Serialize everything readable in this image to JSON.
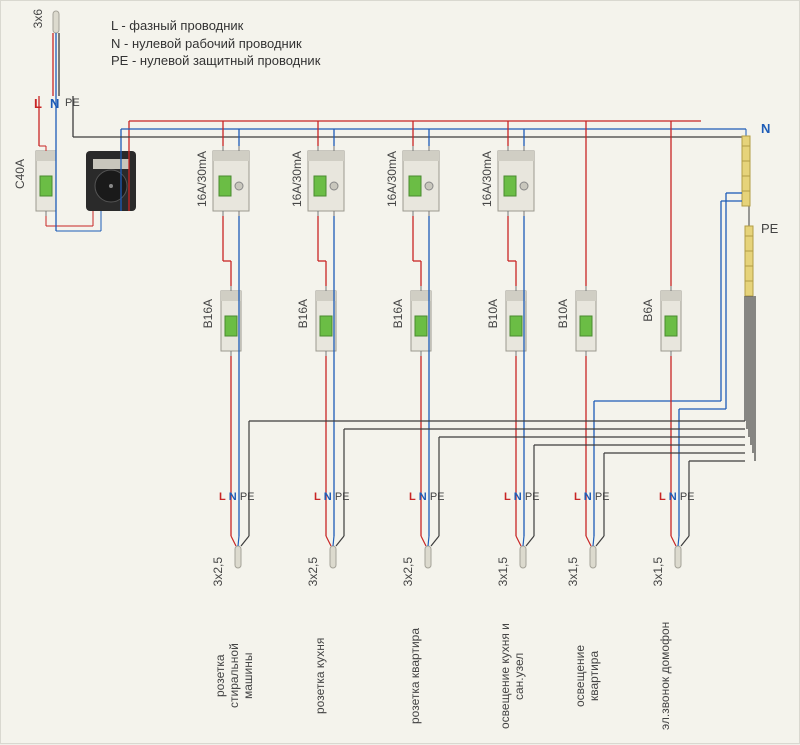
{
  "legend": {
    "L": "L - фазный проводник",
    "N": "N - нулевой рабочий проводник",
    "PE": "PE - нулевой защитный проводник"
  },
  "input_cable": "3x6",
  "conductors": {
    "L": "L",
    "N": "N",
    "PE": "PE"
  },
  "main_breaker": "C40A",
  "rcds": [
    "16A/30mA",
    "16A/30mA",
    "16A/30mA",
    "16A/30mA"
  ],
  "circuits": [
    {
      "mcb": "B16A",
      "cable": "3x2,5",
      "name": "розетка стиральной машины"
    },
    {
      "mcb": "B16A",
      "cable": "3x2,5",
      "name": "розетка кухня"
    },
    {
      "mcb": "B16A",
      "cable": "3x2,5",
      "name": "розетка квартира"
    },
    {
      "mcb": "B10A",
      "cable": "3x1,5",
      "name": "освещение кухня и сан.узел"
    },
    {
      "mcb": "B10A",
      "cable": "3x1,5",
      "name": "освещение квартира"
    },
    {
      "mcb": "B6A",
      "cable": "3x1,5",
      "name": "эл.звонок домофон"
    }
  ],
  "busbars": {
    "N": "N",
    "PE": "PE"
  }
}
